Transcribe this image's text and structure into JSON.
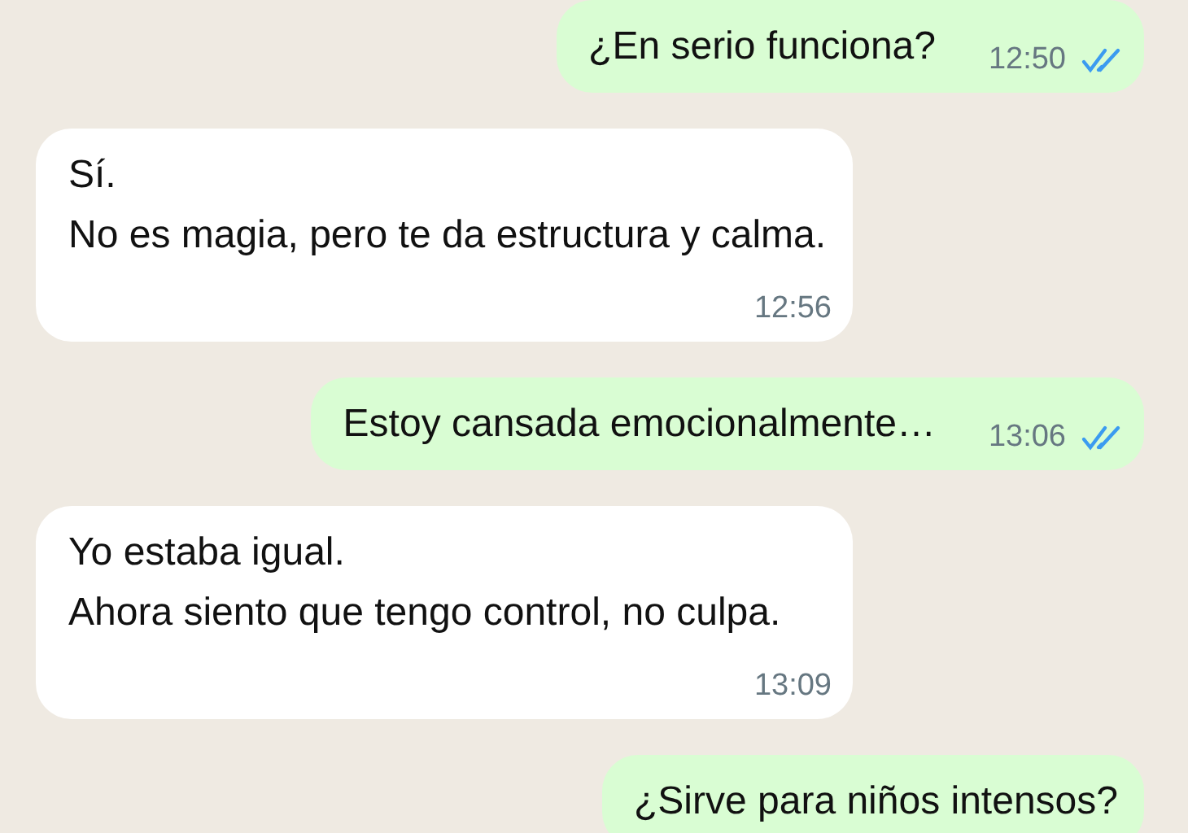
{
  "messages": [
    {
      "kind": "sent",
      "lines": [
        "¿En serio funciona?"
      ],
      "time": "12:50",
      "read": true
    },
    {
      "kind": "received",
      "lines": [
        "Sí.",
        "No es magia, pero te da estructura y calma."
      ],
      "time": "12:56"
    },
    {
      "kind": "sent",
      "lines": [
        "Estoy cansada emocionalmente…"
      ],
      "time": "13:06",
      "read": true
    },
    {
      "kind": "received",
      "lines": [
        "Yo estaba igual.",
        "Ahora siento que tengo control, no culpa."
      ],
      "time": "13:09"
    },
    {
      "kind": "sent",
      "lines": [
        "¿Sirve para niños intensos?"
      ]
    }
  ]
}
